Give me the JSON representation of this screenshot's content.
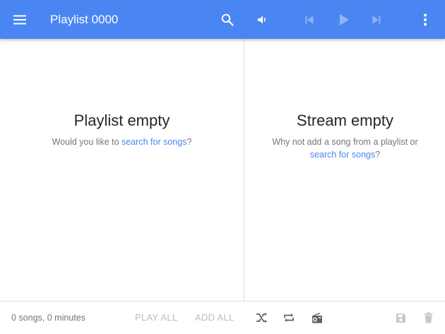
{
  "colors": {
    "accent": "#4a86f2",
    "header_text": "#ffffff",
    "muted_text": "#757575",
    "disabled": "#bdbdbd"
  },
  "header": {
    "title": "Playlist 0000",
    "icons": [
      "menu-icon",
      "search-icon",
      "volume-icon",
      "skip-previous-icon",
      "play-icon",
      "skip-next-icon",
      "more-vert-icon"
    ]
  },
  "playlist_pane": {
    "title": "Playlist empty",
    "prompt_prefix": "Would you like to ",
    "prompt_link": "search for songs",
    "prompt_suffix": "?"
  },
  "stream_pane": {
    "title": "Stream empty",
    "prompt_prefix": "Why not add a song from a playlist or ",
    "prompt_link": "search for songs",
    "prompt_suffix": "?"
  },
  "footer": {
    "summary": "0 songs, 0 minutes",
    "play_all_label": "PLAY ALL",
    "add_all_label": "ADD ALL",
    "icons": [
      "shuffle-icon",
      "repeat-icon",
      "radio-icon",
      "save-icon",
      "delete-icon"
    ]
  }
}
